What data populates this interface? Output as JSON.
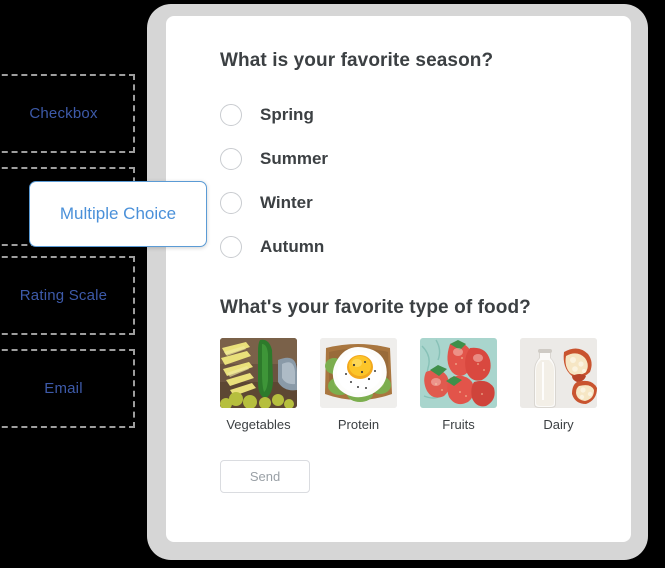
{
  "sidebar": {
    "items": [
      {
        "label": "Checkbox",
        "selected": false
      },
      {
        "label": "Multiple Choice",
        "selected": true
      },
      {
        "label": "Rating Scale",
        "selected": false
      },
      {
        "label": "Email",
        "selected": false
      }
    ],
    "selected_label": "Multiple Choice",
    "text_color": "#3d5aa9",
    "selected_text_color": "#4a90d9",
    "selected_border_color": "#5b9bd5",
    "dash_border_color": "#9e9e9e",
    "background_color": "#000000"
  },
  "form": {
    "questions": [
      {
        "title": "What is your favorite season?",
        "type": "radio",
        "options": [
          {
            "label": "Spring",
            "checked": false
          },
          {
            "label": "Summer",
            "checked": false
          },
          {
            "label": "Winter",
            "checked": false
          },
          {
            "label": "Autumn",
            "checked": false
          }
        ]
      },
      {
        "title": "What's your favorite type of food?",
        "type": "image-choice",
        "options": [
          {
            "label": "Vegetables",
            "image": "vegetables-photo",
            "checked": false
          },
          {
            "label": "Protein",
            "image": "fried-egg-toast-photo",
            "checked": false
          },
          {
            "label": "Fruits",
            "image": "strawberries-photo",
            "checked": false
          },
          {
            "label": "Dairy",
            "image": "milk-bottle-bread-photo",
            "checked": false
          }
        ]
      }
    ],
    "submit_label": "Send",
    "submit_text_color": "#9aa0a6",
    "title_color": "#3c4043",
    "card_background": "#ffffff",
    "frame_color": "#d6d6d6"
  }
}
